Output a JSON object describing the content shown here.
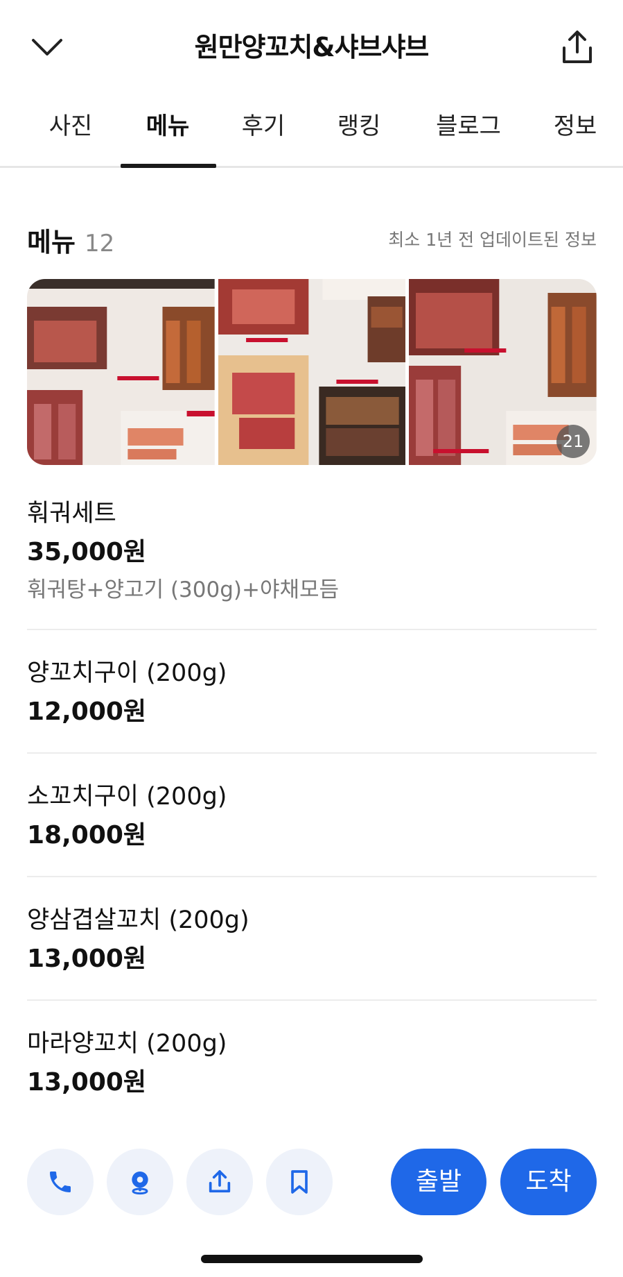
{
  "header": {
    "title": "원만양꼬치&샤브샤브",
    "back_icon": "chevron-down-icon",
    "share_icon": "share-icon"
  },
  "tabs": [
    {
      "label": "사진",
      "active": false
    },
    {
      "label": "메뉴",
      "active": true
    },
    {
      "label": "후기",
      "active": false
    },
    {
      "label": "랭킹",
      "active": false
    },
    {
      "label": "블로그",
      "active": false
    },
    {
      "label": "정보",
      "active": false
    }
  ],
  "menu_section": {
    "title": "메뉴",
    "count": "12",
    "updated": "최소 1년 전 업데이트된 정보"
  },
  "gallery": {
    "photo_count": "21"
  },
  "menu_items": [
    {
      "name": "훠궈세트",
      "price": "35,000원",
      "desc": "훠궈탕+양고기 (300g)+야채모듬"
    },
    {
      "name": "양꼬치구이 (200g)",
      "price": "12,000원"
    },
    {
      "name": "소꼬치구이 (200g)",
      "price": "18,000원"
    },
    {
      "name": "양삼겹살꼬치 (200g)",
      "price": "13,000원"
    },
    {
      "name": "마라양꼬치 (200g)",
      "price": "13,000원"
    }
  ],
  "bottom_bar": {
    "call_icon": "phone-icon",
    "location_icon": "map-pin-icon",
    "share_icon": "share-icon",
    "bookmark_icon": "bookmark-icon",
    "depart_label": "출발",
    "arrive_label": "도착"
  },
  "colors": {
    "accent": "#1f68e8",
    "round_btn_bg": "#eef2fa"
  }
}
